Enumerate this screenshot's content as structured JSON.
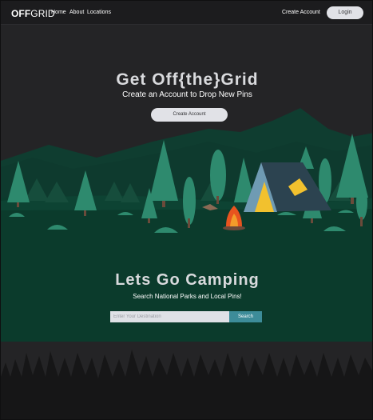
{
  "nav": {
    "logo_bold": "OFF",
    "logo_light": "GRID",
    "links": [
      "Home",
      "About",
      "Locations"
    ],
    "create_account": "Create Account",
    "login": "Login"
  },
  "hero": {
    "title": "Get Off{the}Grid",
    "subtitle": "Create an Account to Drop New Pins",
    "button": "Create Account"
  },
  "camping": {
    "title": "Lets Go Camping",
    "subtitle": "Search National Parks and Local Pins!",
    "search_placeholder": "Enter Your Destination",
    "search_button": "Search"
  },
  "colors": {
    "background": "#242426",
    "forest_floor": "#0b3b2c",
    "tree": "#2e8a6e",
    "tent": "#2c4350",
    "tent_flap": "#f2c12e",
    "search_button": "#3d8c99"
  }
}
